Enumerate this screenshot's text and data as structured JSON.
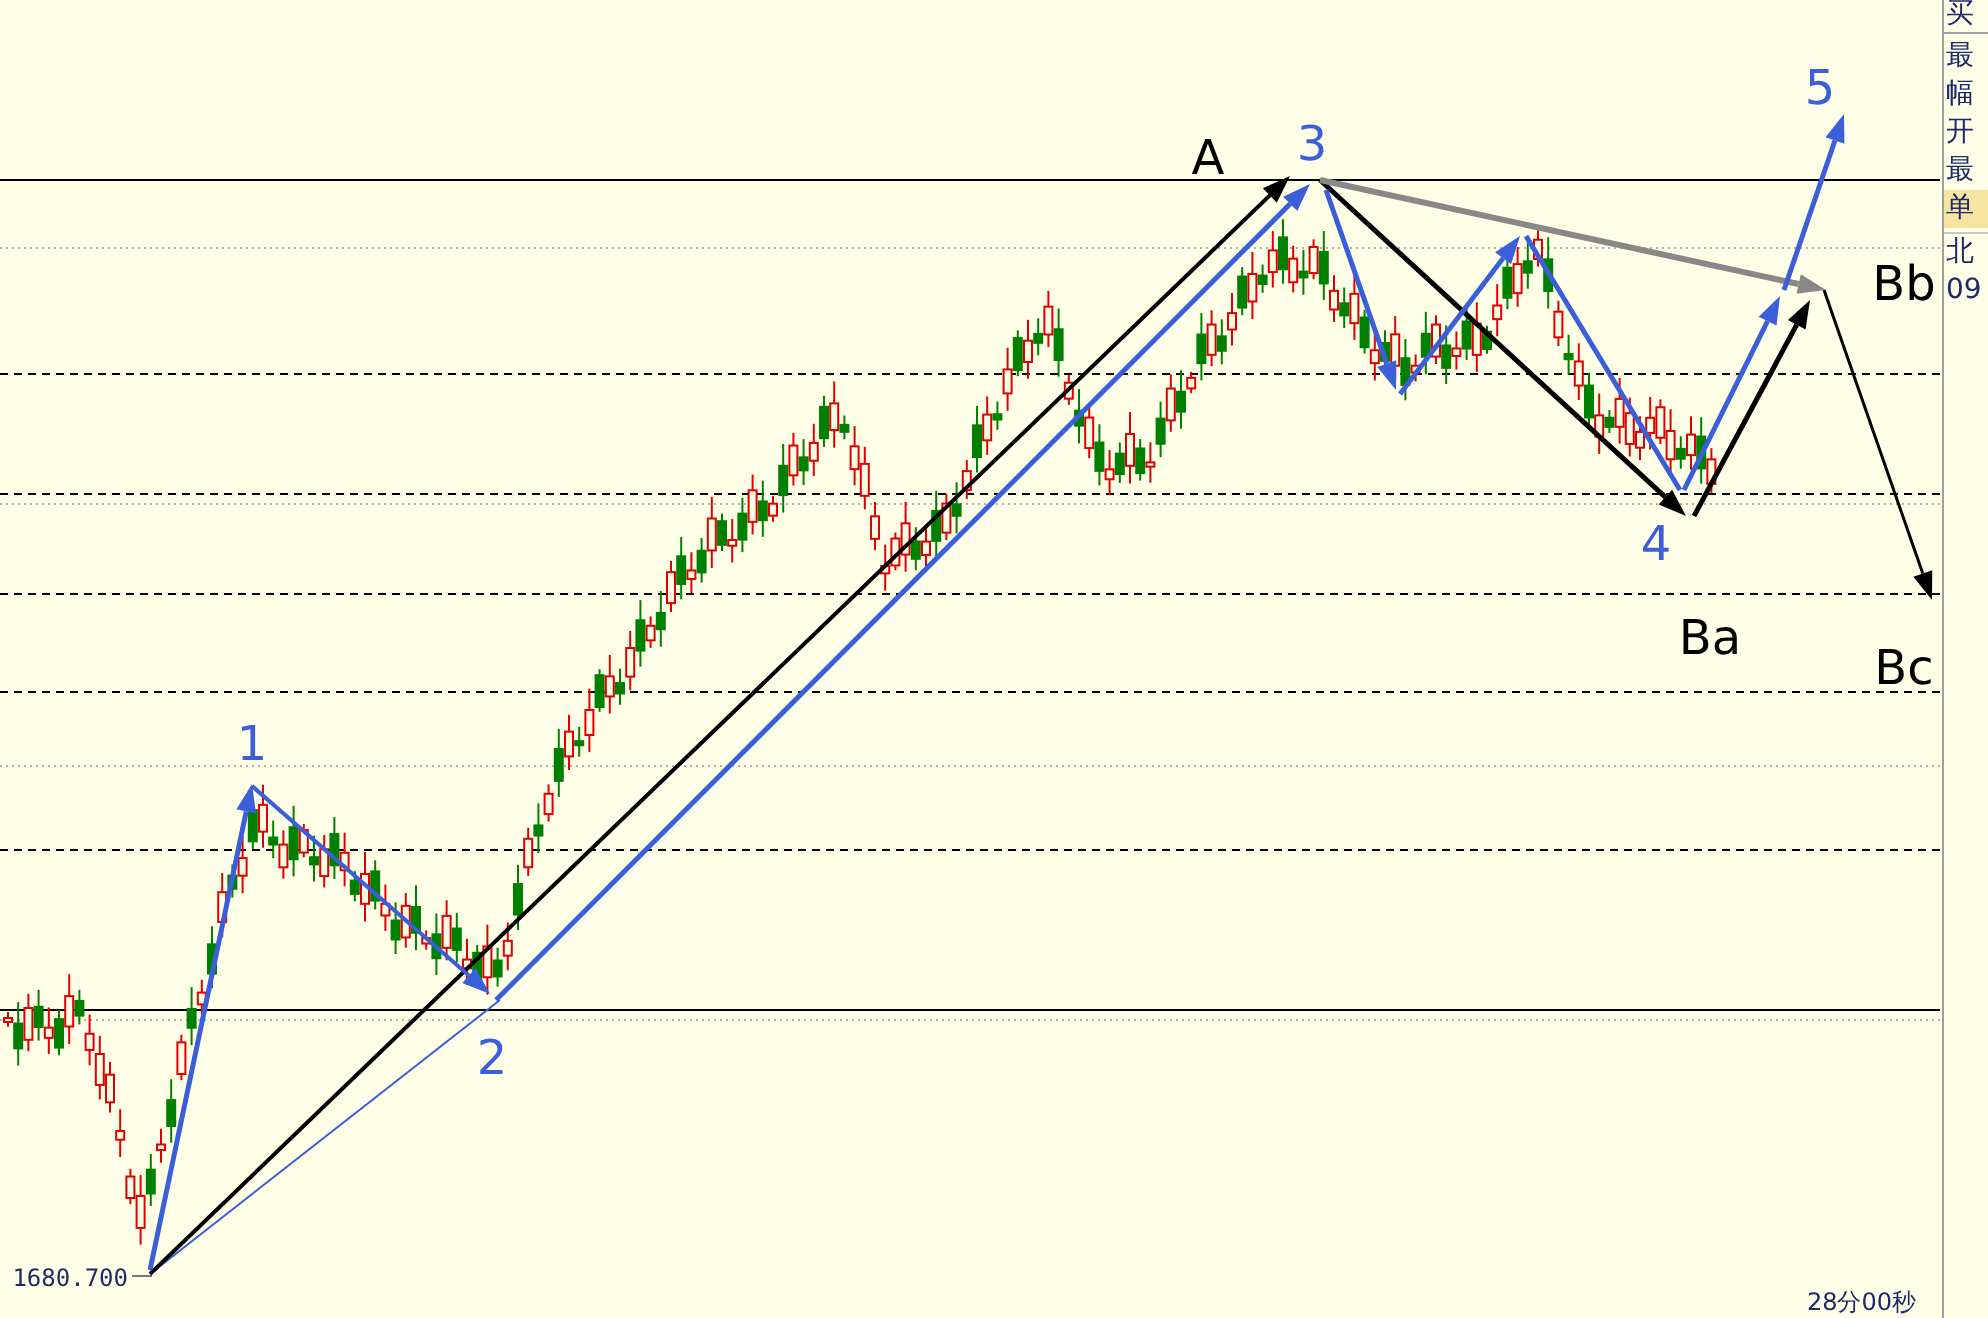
{
  "chart": {
    "wave_labels": [
      {
        "text": "1",
        "kind": "blue"
      },
      {
        "text": "2",
        "kind": "blue"
      },
      {
        "text": "3",
        "kind": "blue"
      },
      {
        "text": "4",
        "kind": "blue"
      },
      {
        "text": "5",
        "kind": "blue"
      },
      {
        "text": "A",
        "kind": "black"
      },
      {
        "text": "Ba",
        "kind": "black"
      },
      {
        "text": "Bb",
        "kind": "black"
      },
      {
        "text": "Bc",
        "kind": "black"
      }
    ],
    "low_price": "1680.700",
    "time_remaining": "28分00秒"
  },
  "side_panel": {
    "items": [
      {
        "text": "买",
        "highlighted": false
      },
      {
        "text": "最",
        "highlighted": false
      },
      {
        "text": "幅",
        "highlighted": false
      },
      {
        "text": "开",
        "highlighted": false
      },
      {
        "text": "最",
        "highlighted": false
      },
      {
        "text": "单",
        "highlighted": true
      },
      {
        "text": "北",
        "highlighted": false
      },
      {
        "text": "09",
        "highlighted": false
      }
    ]
  }
}
